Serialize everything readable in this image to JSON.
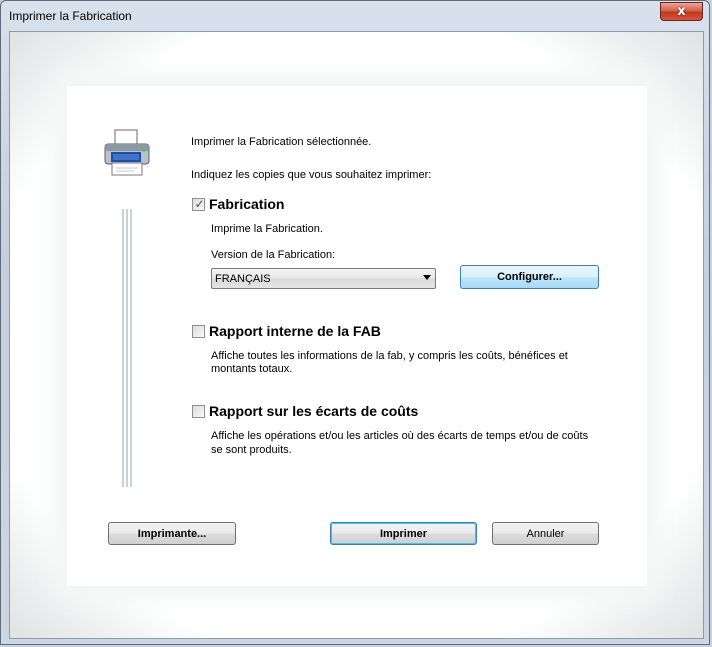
{
  "window": {
    "title": "Imprimer la Fabrication",
    "close_label": "x"
  },
  "intro": {
    "line1": "Imprimer la Fabrication sélectionnée.",
    "line2": "Indiquez les copies que vous souhaitez imprimer:"
  },
  "sections": {
    "fabrication": {
      "title": "Fabrication",
      "checked": true,
      "description": "Imprime la Fabrication.",
      "version_label": "Version de la Fabrication:",
      "version_value": "FRANÇAIS",
      "configure_label": "Configurer..."
    },
    "internal_report": {
      "title": "Rapport interne de la FAB",
      "checked": false,
      "desc_line1": "Affiche toutes les informations de la fab, y compris les coûts, bénéfices et",
      "desc_line2": "montants totaux."
    },
    "cost_report": {
      "title": "Rapport sur les écarts de coûts",
      "checked": false,
      "desc_line1": "Affiche les opérations et/ou les articles où des écarts de temps et/ou de coûts",
      "desc_line2": "se sont produits."
    }
  },
  "buttons": {
    "printer": "Imprimante...",
    "print": "Imprimer",
    "cancel": "Annuler"
  },
  "icons": {
    "printer": "printer-icon",
    "checkmark": "✓"
  },
  "colors": {
    "accent": "#3c7fb1",
    "hover": "#bee6fd"
  }
}
